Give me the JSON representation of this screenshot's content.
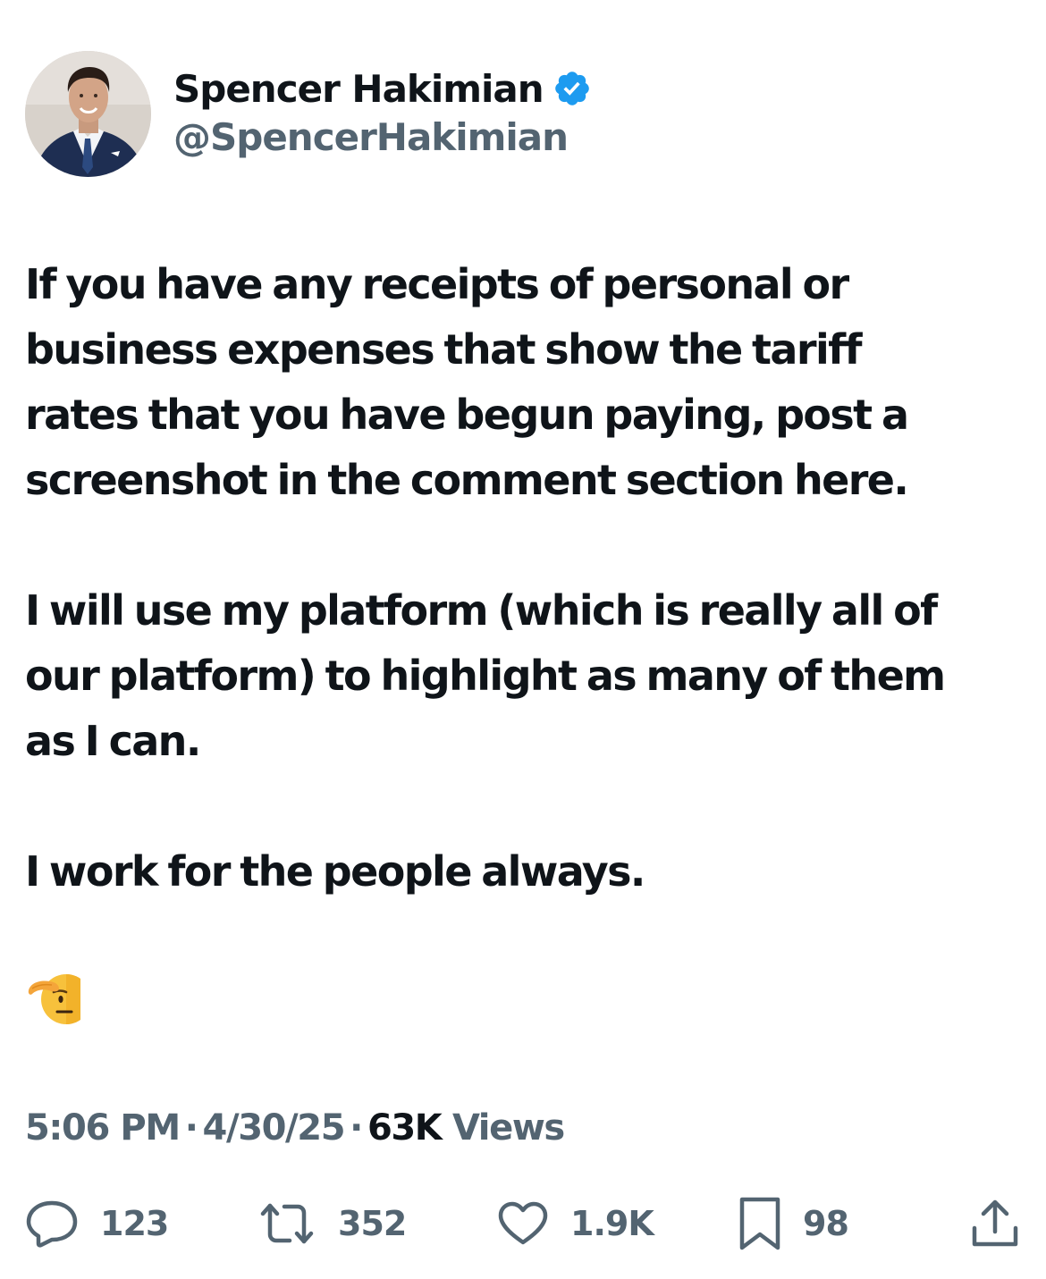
{
  "author": {
    "display_name": "Spencer Hakimian",
    "handle": "@SpencerHakimian",
    "verified_color": "#1d9bf0"
  },
  "tweet": {
    "paragraphs": [
      "If you have any receipts of personal or\nbusiness expenses that show the tariff\nrates that you have begun paying, post a\nscreenshot in the comment section here.",
      "I will use my platform (which is really all of\nour platform) to highlight as many of them\nas I can.",
      "I work for the people always."
    ],
    "emoji": "saluting-face"
  },
  "meta": {
    "time": "5:06 PM",
    "date": "4/30/25",
    "views_count": "63K",
    "views_label": "Views"
  },
  "actions": {
    "replies": "123",
    "retweets": "352",
    "likes": "1.9K",
    "bookmarks": "98",
    "icon_color": "#536471"
  }
}
